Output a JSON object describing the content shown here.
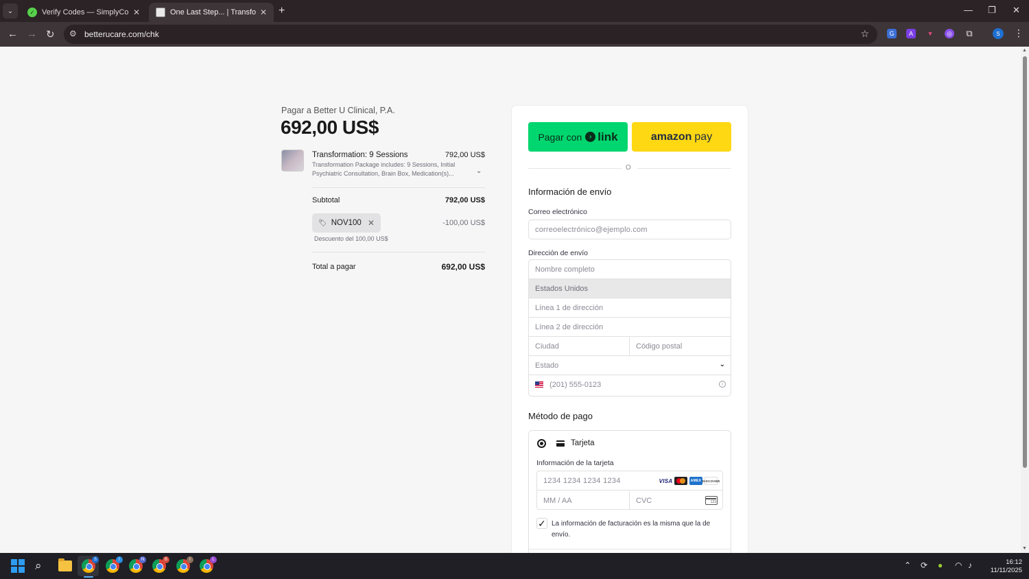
{
  "browser": {
    "tabs": [
      {
        "title": "Verify Codes — SimplyCodes",
        "active": false
      },
      {
        "title": "One Last Step... | Transform Your",
        "active": true
      }
    ],
    "url": "betterucare.com/chk",
    "profile_initial": "S",
    "extension_icons": [
      "translate-icon",
      "text-a-icon",
      "tag-icon",
      "circle-app-icon",
      "puzzle-icon"
    ]
  },
  "summary": {
    "merchant": "Pagar a Better U Clinical, P.A.",
    "total_big": "692,00 US$",
    "product": {
      "name": "Transformation: 9 Sessions",
      "price": "792,00 US$",
      "description": "Transformation Package includes: 9 Sessions, Initial Psychiatric Consultation, Brain Box, Medication(s)..."
    },
    "subtotal_label": "Subtotal",
    "subtotal_value": "792,00 US$",
    "promo_code": "NOV100",
    "promo_amount": "-100,00 US$",
    "promo_note": "Descuento del 100,00 US$",
    "total_label": "Total a pagar",
    "total_value": "692,00 US$"
  },
  "checkout": {
    "link_button_prefix": "Pagar con",
    "link_button_brand": "link",
    "amazon_button_brand": "amazon",
    "amazon_button_suffix": "pay",
    "or_text": "O",
    "shipping_title": "Información de envío",
    "email_label": "Correo electrónico",
    "email_placeholder": "correoelectrónico@ejemplo.com",
    "address_label": "Dirección de envío",
    "name_placeholder": "Nombre completo",
    "country_value": "Estados Unidos",
    "line1_placeholder": "Línea 1 de dirección",
    "line2_placeholder": "Línea 2 de dirección",
    "city_placeholder": "Ciudad",
    "zip_placeholder": "Código postal",
    "state_placeholder": "Estado",
    "phone_placeholder": "(201) 555-0123",
    "payment_title": "Método de pago",
    "card_option": "Tarjeta",
    "card_info_label": "Información de la tarjeta",
    "card_number_placeholder": "1234 1234 1234 1234",
    "card_brands": [
      "VISA",
      "Mastercard",
      "AMEX",
      "DISCOVER"
    ],
    "expiry_placeholder": "MM / AA",
    "cvc_placeholder": "CVC",
    "billing_same_text": "La información de facturación es la misma que la de envío.",
    "billing_same_checked": true
  },
  "taskbar": {
    "time": "16:12",
    "date": "11/11/2025",
    "chrome_badges": [
      "S",
      "I",
      "N",
      "B",
      "I",
      "L"
    ]
  }
}
